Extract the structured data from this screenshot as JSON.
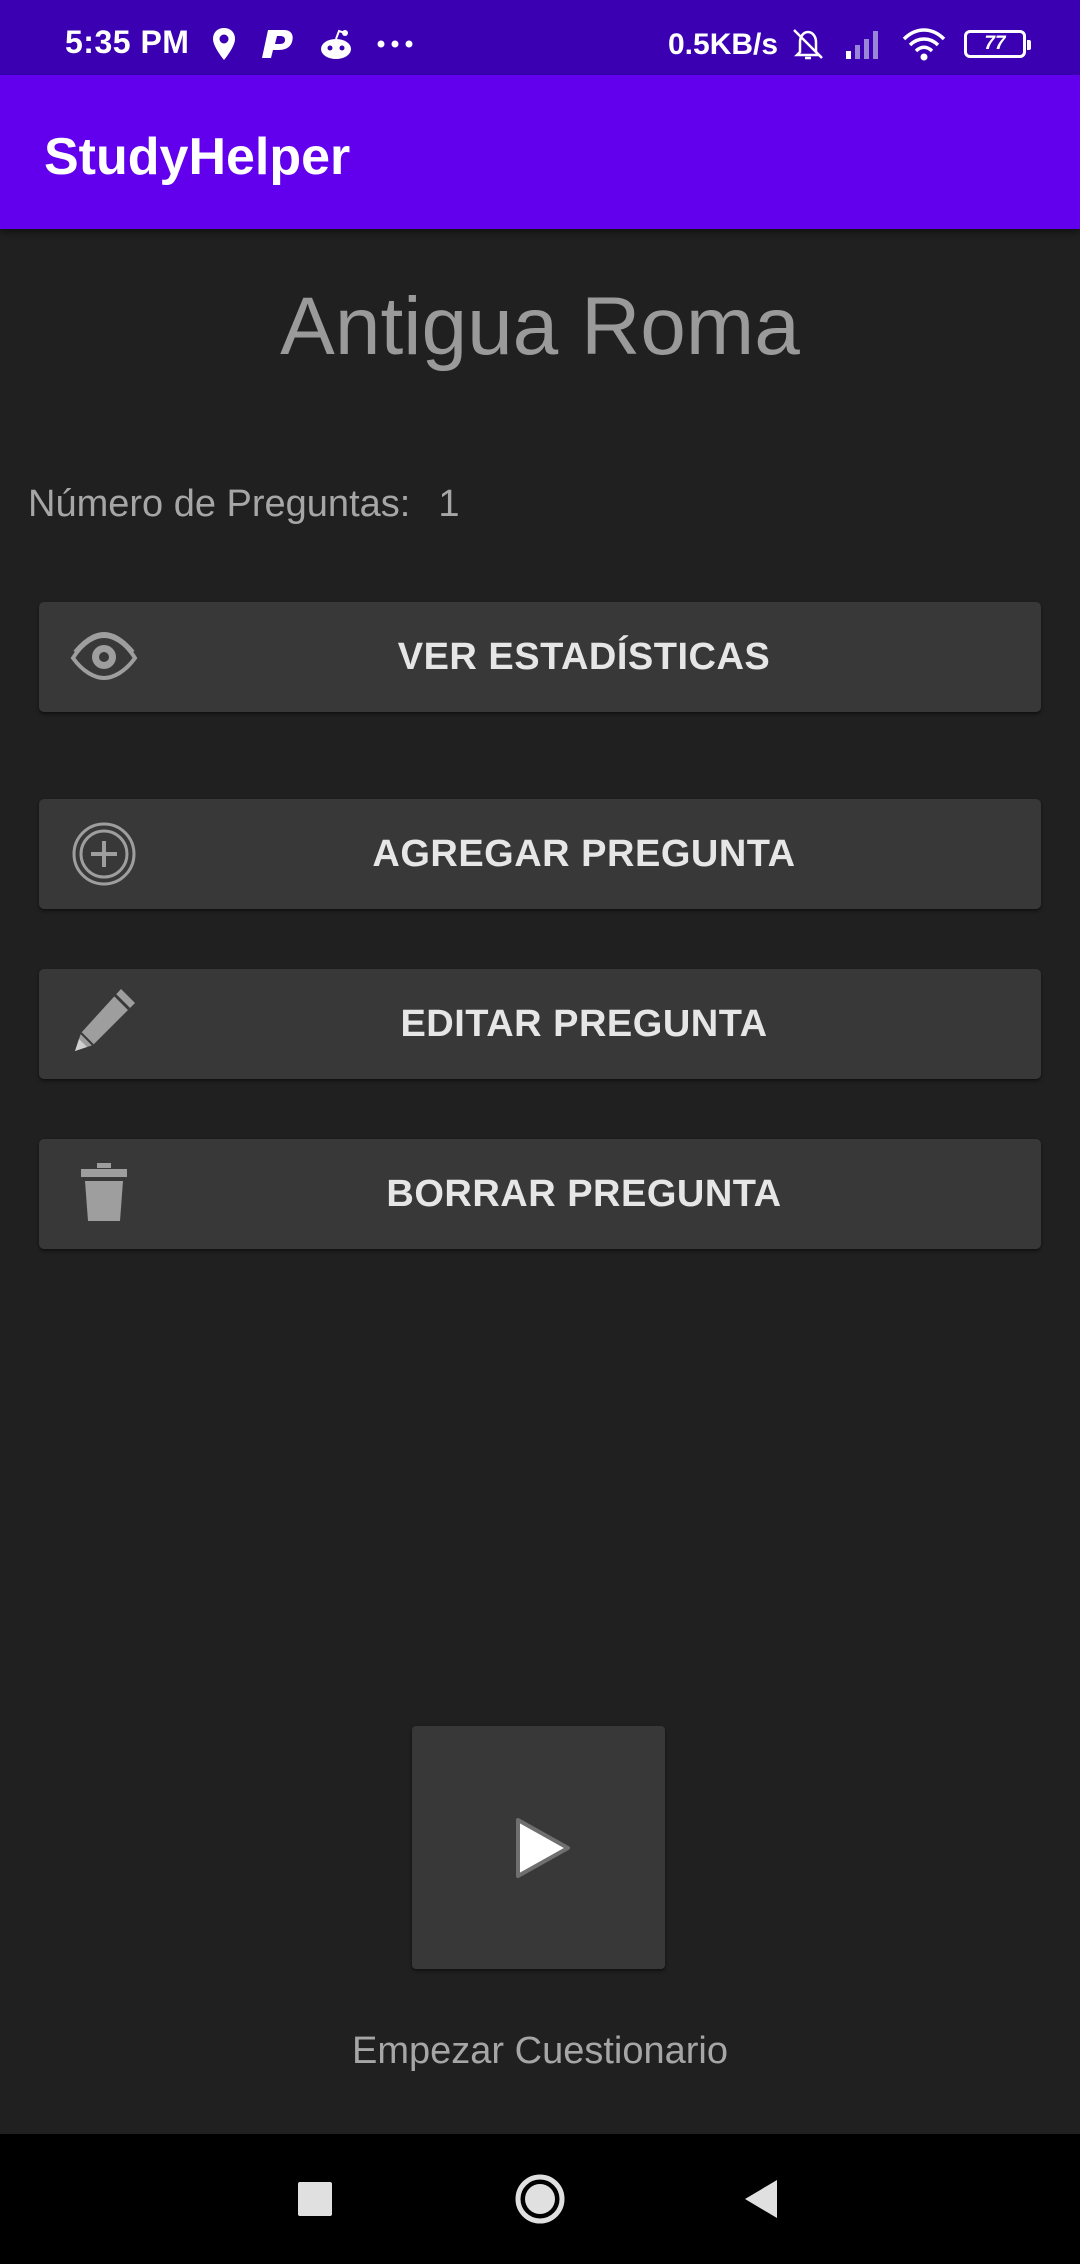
{
  "status_bar": {
    "time": "5:35 PM",
    "more": "···",
    "net_speed": "0.5KB/s",
    "battery": "77",
    "icons_left": [
      "location-icon",
      "p-app-icon",
      "reddit-icon",
      "more-dots-icon"
    ],
    "icons_right": [
      "bell-muted-icon",
      "signal-icon",
      "wifi-icon",
      "battery-icon"
    ]
  },
  "app_bar": {
    "title": "StudyHelper",
    "color": "#6200ee",
    "status_color": "#3a00b2"
  },
  "topic": {
    "title": "Antigua Roma"
  },
  "question_count": {
    "label": "Número de Preguntas:",
    "value": "1"
  },
  "actions": [
    {
      "label": "VER ESTADÍSTICAS",
      "icon": "eye-icon"
    },
    {
      "label": "AGREGAR PREGUNTA",
      "icon": "plus-circle-icon"
    },
    {
      "label": "EDITAR PREGUNTA",
      "icon": "pencil-icon"
    },
    {
      "label": "BORRAR PREGUNTA",
      "icon": "trash-icon"
    }
  ],
  "start": {
    "icon": "play-icon",
    "label": "Empezar Cuestionario"
  },
  "nav_bar": {
    "buttons": [
      "recents-square-icon",
      "home-circle-icon",
      "back-triangle-icon"
    ]
  }
}
